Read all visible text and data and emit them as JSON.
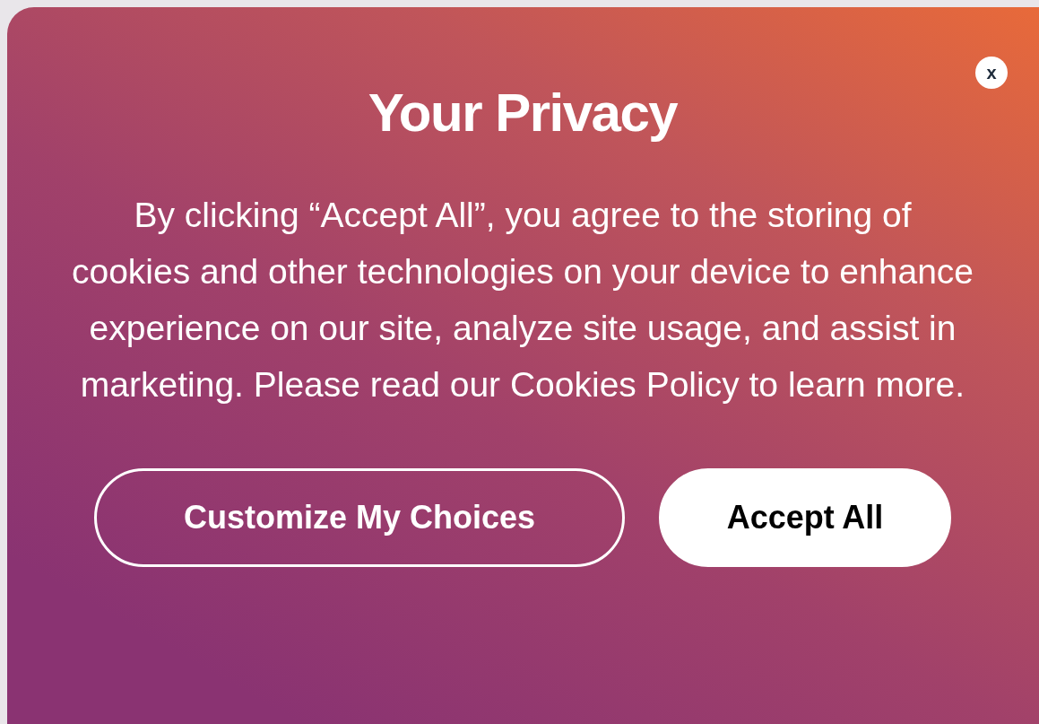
{
  "dialog": {
    "title": "Your Privacy",
    "close": "x",
    "message": "By clicking “Accept All”, you agree to the storing of cookies and other technologies on your device to enhance experience on our site, analyze site usage, and assist in marketing. Please read our Cookies Policy to learn more.",
    "buttons": [
      {
        "kind": "outline",
        "label": "Customize My Choices"
      },
      {
        "kind": "solid",
        "label": "Accept All"
      }
    ]
  }
}
